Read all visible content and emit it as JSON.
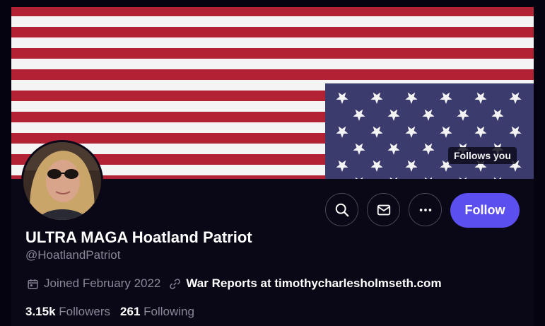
{
  "banner": {
    "description_colors": {
      "red": "#b22234",
      "white": "#f4f4f4",
      "blue": "#3c3b6e"
    },
    "follows_you": "Follows you"
  },
  "actions": {
    "search_icon": "search-icon",
    "message_icon": "mail-icon",
    "more_icon": "more-icon",
    "follow_label": "Follow"
  },
  "profile": {
    "display_name": "ULTRA MAGA Hoatland Patriot",
    "handle": "@HoatlandPatriot",
    "joined": "Joined February 2022",
    "website": "War Reports at timothycharlesholmseth.com"
  },
  "stats": {
    "followers_count": "3.15k",
    "followers_label": "Followers",
    "following_count": "261",
    "following_label": "Following"
  },
  "colors": {
    "accent": "#5b4ff0",
    "background": "#0a0716"
  }
}
